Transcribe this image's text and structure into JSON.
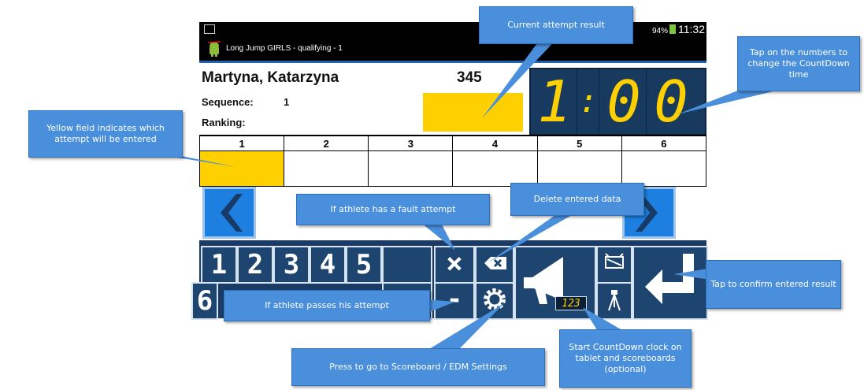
{
  "status_bar": {
    "battery": "94%",
    "time": "11:32"
  },
  "title_bar": {
    "title": "Long Jump GIRLS - qualifying - 1"
  },
  "athlete": {
    "name": "Martyna, Katarzyna",
    "bib": "345",
    "sequence_label": "Sequence:",
    "sequence_value": "1",
    "ranking_label": "Ranking:"
  },
  "clock": {
    "d1": "1",
    "colon": ":",
    "d2": "0",
    "d3": "0"
  },
  "attempts": {
    "headers": [
      "1",
      "2",
      "3",
      "4",
      "5",
      "6"
    ],
    "active_index": 0
  },
  "keypad": {
    "row1": [
      "1",
      "2",
      "3",
      "4",
      "5"
    ],
    "row2_first": "6",
    "fault_symbol": "×",
    "pass_symbol": "-",
    "mini_clock": "123"
  },
  "callouts": {
    "current_result": "Current attempt result",
    "countdown_tap": "Tap on the numbers to change the CountDown time",
    "yellow_field": "Yellow field indicates which attempt will be entered",
    "delete": "Delete entered data",
    "fault": "If athlete has a fault attempt",
    "confirm": "Tap to confirm entered result",
    "pass": "If athlete passes his attempt",
    "countdown_start": "Start CountDown clock on tablet and scoreboards (optional)",
    "settings": "Press to go to Scoreboard / EDM Settings"
  },
  "colors": {
    "accent_yellow": "#ffd000",
    "keypad_blue": "#1a3b66",
    "callout_blue": "#4a8fdc",
    "nav_blue": "#1d7fe0"
  }
}
